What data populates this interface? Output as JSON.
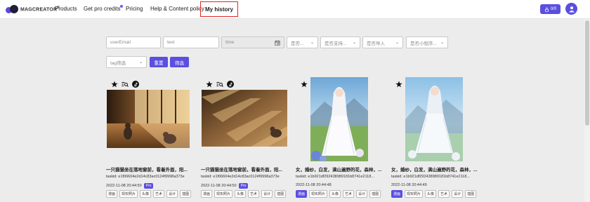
{
  "header": {
    "logo_text": "MAGCREATOR",
    "logo_mark": "®",
    "nav": {
      "products": "Products",
      "pro_credits": "Get pro credits",
      "pricing": "Pricing",
      "help": "Help & Content policy",
      "history": "My history"
    },
    "credits": "0/0"
  },
  "filters": {
    "user_email_placeholder": "userEmail",
    "text_placeholder": "text",
    "time_placeholder": "time",
    "select1": "是否...",
    "select2": "是否支持...",
    "select3": "是否导入",
    "select4": "是否小程序...",
    "tag_select": "tag筛选",
    "reset_button": "重置",
    "filter_button": "筛选"
  },
  "cards": [
    {
      "title": "一只猫猫坐在落地窗前，看着外面，阳...",
      "taskid": "taskid: e1f06604e2d14c83ac0124f9998a373e",
      "date": "2022-11-08 20:44:50",
      "badge": "Pro",
      "tags": [
        "漫画",
        "现实照片",
        "头像",
        "艺术",
        "设计",
        "插图"
      ],
      "active_tag": -1
    },
    {
      "title": "一只猫猫坐在落地窗前，看着外面，阳...",
      "taskid": "taskid: e1f06604e2d14c83ac0124f9998a373e",
      "date": "2022-11-08 20:44:50",
      "badge": "Pro",
      "tags": [
        "漫画",
        "现实照片",
        "头像",
        "艺术",
        "设计",
        "插图"
      ],
      "active_tag": -1
    },
    {
      "title": "女，婚纱，白发，满山遍野的花，森林，...",
      "taskid": "taskid: e1b921df292438989181b8741e2118...",
      "date": "2022-11-08 20:44:48",
      "badge": "",
      "tags": [
        "漫画",
        "现实照片",
        "头像",
        "艺术",
        "设计",
        "插图"
      ],
      "active_tag": 0
    },
    {
      "title": "女，婚纱，白发，满山遍野的花，森林，...",
      "taskid": "taskid: e1b921df292438989181b8741e2118...",
      "date": "2022-11-08 20:44:49",
      "badge": "",
      "tags": [
        "漫画",
        "现实照片",
        "头像",
        "艺术",
        "设计",
        "插图"
      ],
      "active_tag": 0
    }
  ],
  "colors": {
    "accent": "#5b4fe0",
    "highlight_border": "#e02424"
  },
  "icons": [
    "star-icon",
    "search-similar-icon",
    "tiktok-icon"
  ]
}
